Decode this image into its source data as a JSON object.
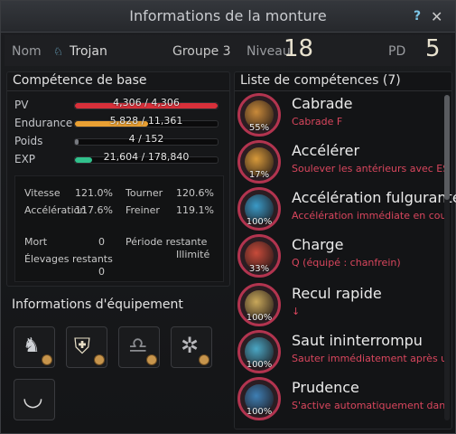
{
  "window": {
    "title": "Informations de la monture"
  },
  "header": {
    "name_label": "Nom",
    "name_value": "Trojan",
    "group_label": "Groupe 3",
    "level_label": "Niveau",
    "level_value": "18",
    "pd_label": "PD",
    "pd_value": "5"
  },
  "base": {
    "title": "Compétence de base",
    "bars": [
      {
        "label": "PV",
        "text": "4,306 / 4,306",
        "fraction": 1.0,
        "color": "#d8303a"
      },
      {
        "label": "Endurance",
        "text": "5,828 / 11,361",
        "fraction": 0.513,
        "color": "#e9a033"
      },
      {
        "label": "Poids",
        "text": "4 / 152",
        "fraction": 0.026,
        "color": "#777a80"
      },
      {
        "label": "EXP",
        "text": "21,604 / 178,840",
        "fraction": 0.121,
        "color": "#31c18c"
      }
    ],
    "stats": {
      "speed_label": "Vitesse",
      "speed_value": "121.0%",
      "turn_label": "Tourner",
      "turn_value": "120.6%",
      "accel_label": "Accélération",
      "accel_value": "117.6%",
      "brake_label": "Freiner",
      "brake_value": "119.1%",
      "death_label": "Mort",
      "death_value": "0",
      "period_label": "Période restante",
      "period_value": "Illimité",
      "breed_label": "Élevages restants",
      "breed_value": "0"
    }
  },
  "equipment": {
    "title": "Informations d'équipement",
    "slots": [
      "saddle-icon",
      "armor-icon",
      "stirrups-icon",
      "horseshoe-icon",
      "headgear-icon"
    ]
  },
  "skills": {
    "title": "Liste de compétences (7)",
    "items": [
      {
        "name": "Cabrade",
        "desc": "Cabrade F",
        "pct": "55%",
        "color": "#c98a3a"
      },
      {
        "name": "Accélérer",
        "desc": "Soulever les antérieurs avec ESP",
        "pct": "17%",
        "color": "#d89a3a"
      },
      {
        "name": "Accélération fulgurante",
        "desc": "Accélération immédiate en courant",
        "pct": "100%",
        "color": "#3a9ac7"
      },
      {
        "name": "Charge",
        "desc": "Q (équipé : chanfrein)",
        "pct": "33%",
        "color": "#c84b3a"
      },
      {
        "name": "Recul rapide",
        "desc": "↓",
        "pct": "100%",
        "color": "#c9a85a"
      },
      {
        "name": "Saut ininterrompu",
        "desc": "Sauter immédiatement après une",
        "pct": "100%",
        "color": "#4aa7c5"
      },
      {
        "name": "Prudence",
        "desc": "S'active automatiquement dans",
        "pct": "100%",
        "color": "#3e7fb4"
      }
    ]
  }
}
